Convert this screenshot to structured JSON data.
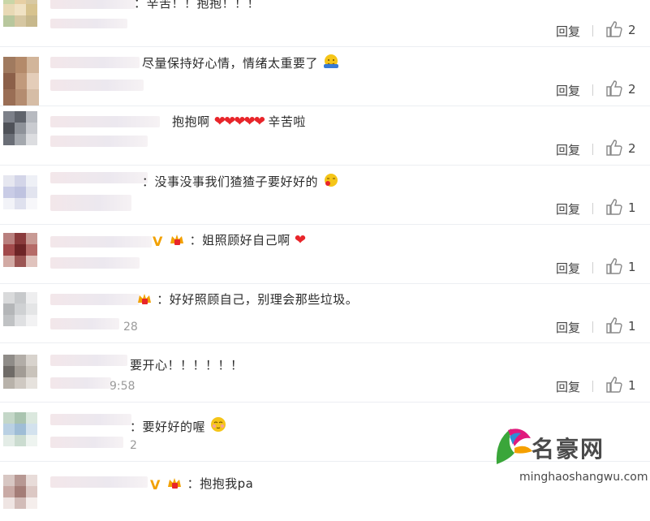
{
  "comments": [
    {
      "text": "：辛苦！！抱抱！！！",
      "time": "",
      "reply": "回复",
      "likes": "2"
    },
    {
      "text": "尽量保持好心情，情绪太重要了",
      "time": "",
      "reply": "回复",
      "likes": "2"
    },
    {
      "text": "抱抱啊",
      "text2": "辛苦啦",
      "time": "",
      "reply": "回复",
      "likes": "2"
    },
    {
      "text": "：没事没事我们猹猹子要好好的",
      "time": "",
      "reply": "回复",
      "likes": "1"
    },
    {
      "text": "：姐照顾好自己啊",
      "time": "",
      "reply": "回复",
      "likes": "1"
    },
    {
      "text": "：好好照顾自己，别理会那些垃圾。",
      "time": "28",
      "reply": "回复",
      "likes": "1"
    },
    {
      "text": "要开心！！！！！！",
      "time": "9:58",
      "reply": "回复",
      "likes": "1"
    },
    {
      "text": "：要好好的喔",
      "time": "2",
      "reply": "回复",
      "likes": "1"
    },
    {
      "text": "：抱抱我pa",
      "time": "",
      "reply": "回复",
      "likes": ""
    }
  ],
  "watermark": {
    "title": "名豪网",
    "url": "minghaoshangwu.com"
  },
  "colors": {
    "like_icon": "#888888",
    "heart": "#e8252a",
    "badge": "#f2a100"
  }
}
